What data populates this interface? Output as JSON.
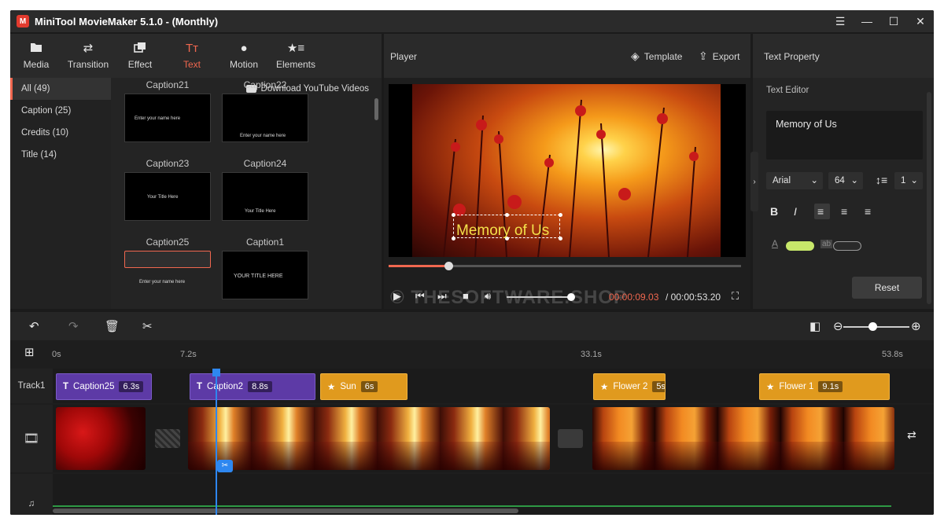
{
  "window": {
    "title": "MiniTool MovieMaker 5.1.0 - (Monthly)",
    "logo_text": "M",
    "controls": [
      "☰",
      "—",
      "☐",
      "✕"
    ]
  },
  "toolbar": {
    "items": [
      {
        "label": "Media",
        "icon": "folder-icon"
      },
      {
        "label": "Transition",
        "icon": "transition-icon"
      },
      {
        "label": "Effect",
        "icon": "effect-icon"
      },
      {
        "label": "Text",
        "icon": "text-icon"
      },
      {
        "label": "Motion",
        "icon": "motion-icon"
      },
      {
        "label": "Elements",
        "icon": "elements-icon"
      }
    ],
    "active": "Text"
  },
  "categories": [
    {
      "label": "All (49)"
    },
    {
      "label": "Caption (25)"
    },
    {
      "label": "Credits (10)"
    },
    {
      "label": "Title (14)"
    }
  ],
  "library": {
    "download_label": "Download YouTube Videos",
    "row_labels": [
      [
        "Caption21",
        "Caption22"
      ],
      [
        "Caption23",
        "Caption24"
      ],
      [
        "Caption25",
        "Caption1"
      ]
    ],
    "thumb_texts": [
      "Enter your name here",
      "Enter your name here",
      "Your Title Here",
      "Your  Title Here",
      "Enter your name here",
      "YOUR TITLE HERE"
    ]
  },
  "player": {
    "title": "Player",
    "template_label": "Template",
    "export_label": "Export",
    "caption_text": "Memory of Us",
    "time_current": "00:00:09.03",
    "time_total": " / 00:00:53.20",
    "watermark": "© THESOFTWARE.SHOP",
    "progress_fraction": 0.17,
    "volume_fraction": 0.95
  },
  "text_property": {
    "title": "Text Property",
    "editor_label": "Text Editor",
    "editor_value": "Memory of Us",
    "font": "Arial",
    "size": "64",
    "line_spacing": "1",
    "reset_label": "Reset",
    "text_color": "#c8e86a",
    "bg_color": "#2a2a2a",
    "bg_label": "ab"
  },
  "timeline": {
    "ruler_labels": [
      "0s",
      "7.2s",
      "33.1s",
      "53.8s"
    ],
    "track_label": "Track1",
    "text_clips": [
      {
        "name": "Caption25",
        "duration": "6.3s",
        "kind": "text"
      },
      {
        "name": "Caption2",
        "duration": "8.8s",
        "kind": "text"
      },
      {
        "name": "Sun",
        "duration": "6s",
        "kind": "element"
      },
      {
        "name": "Flower 2",
        "duration": "5s",
        "kind": "element"
      },
      {
        "name": "Flower 1",
        "duration": "9.1s",
        "kind": "element"
      }
    ]
  },
  "colors": {
    "accent": "#f0674f",
    "text_clip": "#5d3aa6",
    "element_clip": "#e09a1e",
    "playhead": "#2e87f0"
  }
}
